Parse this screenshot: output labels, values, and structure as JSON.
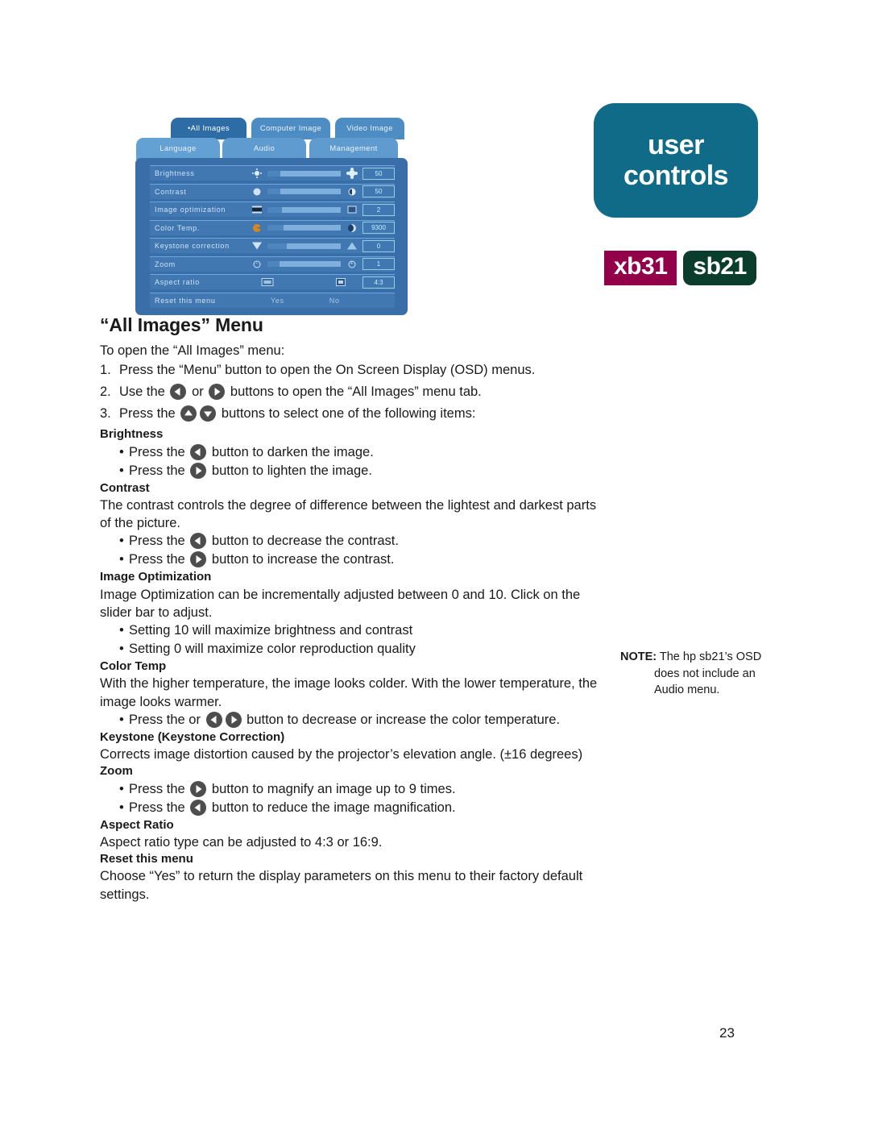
{
  "branding": {
    "title_line1": "user",
    "title_line2": "controls",
    "badge_xb31": "xb31",
    "badge_sb21": "sb21",
    "teal": "#0f6b88",
    "magenta": "#93004a",
    "green": "#0b3d2c"
  },
  "osd": {
    "tabs_row1": [
      {
        "label": "•All Images",
        "active": true
      },
      {
        "label": "Computer Image",
        "active": false
      },
      {
        "label": "Video Image",
        "active": false
      }
    ],
    "tabs_row2": [
      {
        "label": "Language",
        "active": false
      },
      {
        "label": "Audio",
        "active": false
      },
      {
        "label": "Management",
        "active": false
      }
    ],
    "rows": [
      {
        "label": "Brightness",
        "value": "50",
        "left_icon": "sun-small-icon",
        "right_icon": "sun-big-icon",
        "fill": 18
      },
      {
        "label": "Contrast",
        "value": "50",
        "left_icon": "circle-icon",
        "right_icon": "half-circle-icon",
        "fill": 18
      },
      {
        "label": "Image optimization",
        "value": "2",
        "left_icon": "film-icon",
        "right_icon": "monitor-icon",
        "fill": 20
      },
      {
        "label": "Color Temp.",
        "value": "9300",
        "left_icon": "warm-color-icon",
        "right_icon": "cool-moon-icon",
        "fill": 22
      },
      {
        "label": "Keystone correction",
        "value": "0",
        "left_icon": "triangle-down-icon",
        "right_icon": "triangle-up-icon",
        "fill": 26
      },
      {
        "label": "Zoom",
        "value": "1",
        "left_icon": "zoom-out-icon",
        "right_icon": "zoom-in-icon",
        "fill": 16
      },
      {
        "label": "Aspect ratio",
        "value": "4:3",
        "left_icon": "widescreen-icon",
        "right_icon": "standard-screen-icon"
      }
    ],
    "reset_row": {
      "label": "Reset this menu",
      "yes": "Yes",
      "no": "No"
    }
  },
  "heading": "“All Images” Menu",
  "intro": "To open the “All Images” menu:",
  "steps": [
    {
      "num": "1.",
      "pre": "Press the “Menu” button to open the On Screen Display (OSD) menus.",
      "post": ""
    },
    {
      "num": "2.",
      "pre": "Use the",
      "mid": "or",
      "post": "buttons to open the “All Images” menu tab."
    },
    {
      "num": "3.",
      "pre": "Press the",
      "post": "buttons to select one of the following items:"
    }
  ],
  "sections": {
    "brightness": {
      "title": "Brightness",
      "bullet1_pre": "Press the",
      "bullet1_post": "button to darken the image.",
      "bullet2_pre": "Press the",
      "bullet2_post": "button to lighten the image."
    },
    "contrast": {
      "title": "Contrast",
      "body": "The contrast controls the degree of difference between the lightest and darkest parts of the picture.",
      "bullet1_pre": "Press the",
      "bullet1_post": "button to decrease the contrast.",
      "bullet2_pre": "Press the",
      "bullet2_post": "button to increase the contrast."
    },
    "image_optimization": {
      "title": "Image Optimization",
      "body": "Image Optimization can be incrementally adjusted between 0 and 10. Click on the slider bar to adjust.",
      "bullet1": "Setting 10 will maximize brightness and contrast",
      "bullet2": "Setting 0 will maximize color reproduction quality"
    },
    "color_temp": {
      "title": "Color Temp",
      "body": "With the higher temperature, the image looks colder.  With the lower temperature, the image looks warmer.",
      "bullet1_pre": "Press the or",
      "bullet1_post": "button to decrease or increase the color temperature."
    },
    "keystone": {
      "title": "Keystone (Keystone Correction)",
      "body": "Corrects image distortion caused by the projector’s elevation angle. (±16 degrees)"
    },
    "zoom": {
      "title": "Zoom",
      "bullet1_pre": "Press the",
      "bullet1_post": "button to magnify an image up to 9 times.",
      "bullet2_pre": "Press the",
      "bullet2_post": "button to reduce the image magnification."
    },
    "aspect_ratio": {
      "title": "Aspect Ratio",
      "body": "Aspect ratio type can be adjusted to 4:3 or 16:9."
    },
    "reset": {
      "title": "Reset this menu",
      "body": "Choose “Yes” to return the display parameters on this menu to their factory default settings."
    }
  },
  "note": {
    "label": "NOTE:",
    "line1": "The hp sb21’s OSD",
    "line2": "does not include an",
    "line3": "Audio menu."
  },
  "page_number": "23",
  "bullet_char": "•"
}
